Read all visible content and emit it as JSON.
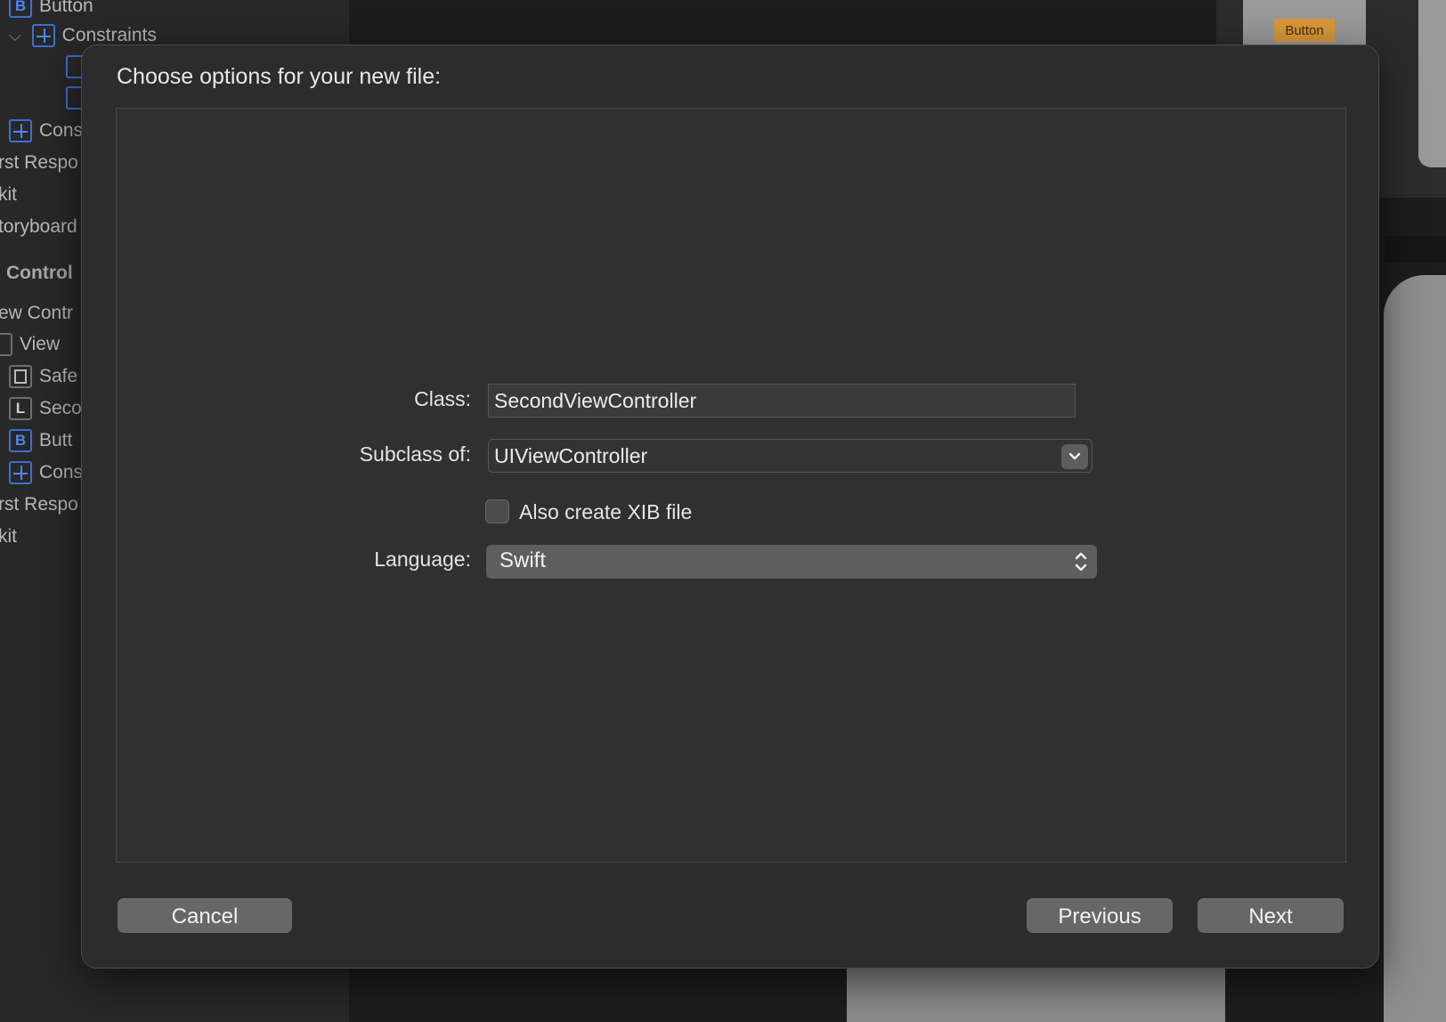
{
  "outline": {
    "items": [
      {
        "text": "Button",
        "icon": "B",
        "kind": "letter-blue"
      },
      {
        "text": "Constraints",
        "icon": "constraints-icon",
        "kind": "cross"
      },
      {
        "text": "",
        "icon": "constraint-item-icon",
        "kind": "plain-blue"
      },
      {
        "text": "",
        "icon": "constraint-item-icon",
        "kind": "plain-blue"
      },
      {
        "text": "Cons",
        "icon": "constraints-icon",
        "kind": "cross"
      },
      {
        "text": "rst Respo",
        "icon": "",
        "kind": "none"
      },
      {
        "text": "kit",
        "icon": "",
        "kind": "none"
      },
      {
        "text": "toryboard",
        "icon": "",
        "kind": "none"
      },
      {
        "text": "Control",
        "icon": "",
        "kind": "section"
      },
      {
        "text": "ew Contr",
        "icon": "",
        "kind": "none"
      },
      {
        "text": "View",
        "icon": "",
        "kind": "none"
      },
      {
        "text": "Safe",
        "icon": "safe-area-icon",
        "kind": "safe"
      },
      {
        "text": "Seco",
        "icon": "L",
        "kind": "letter"
      },
      {
        "text": "Butt",
        "icon": "B",
        "kind": "letter-blue"
      },
      {
        "text": "Cons",
        "icon": "constraints-icon",
        "kind": "cross"
      },
      {
        "text": "rst Respo",
        "icon": "",
        "kind": "none"
      },
      {
        "text": "kit",
        "icon": "",
        "kind": "none"
      }
    ]
  },
  "canvas": {
    "mini_button_label": "Button"
  },
  "dialog": {
    "title": "Choose options for your new file:",
    "class_label": "Class:",
    "class_value": "SecondViewController",
    "subclass_label": "Subclass of:",
    "subclass_value": "UIViewController",
    "xib_label": "Also create XIB file",
    "xib_checked": false,
    "language_label": "Language:",
    "language_value": "Swift",
    "cancel_label": "Cancel",
    "previous_label": "Previous",
    "next_label": "Next"
  }
}
